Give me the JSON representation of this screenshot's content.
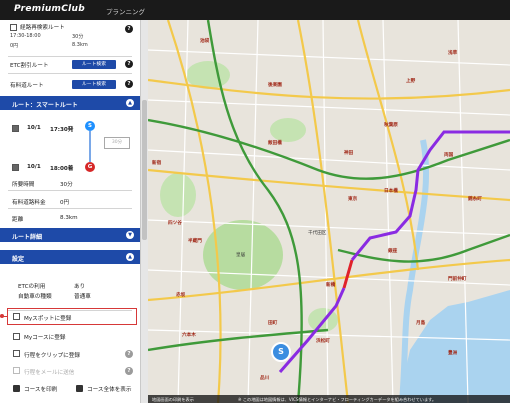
{
  "header": {
    "logo": "PremiumClub",
    "nav": "プランニング"
  },
  "route_summary": {
    "title": "経路再検索ルート",
    "time": "17:30-18:00",
    "duration": "30分",
    "toll": "0円",
    "distance": "8.3km"
  },
  "etc_route": {
    "label": "ETC割引ルート",
    "button": "ルート検索"
  },
  "toll_route": {
    "label": "有料道ルート",
    "button": "ルート検索"
  },
  "smart_route": {
    "section_title": "ルート：スマートルート",
    "start_date": "10/1",
    "start_time": "17:30発",
    "stay_pill": "30分",
    "end_date": "10/1",
    "end_time": "18:00着",
    "start_badge": "S",
    "goal_badge": "G",
    "rows": [
      {
        "label": "所要時間",
        "value": "30分"
      },
      {
        "label": "有料道路料金",
        "value": "0円"
      },
      {
        "label": "距離",
        "value": "8.3km"
      }
    ]
  },
  "route_detail": {
    "title": "ルート詳細"
  },
  "settings": {
    "title": "設定",
    "rows": [
      {
        "label": "ETCの利用",
        "value": "あり"
      },
      {
        "label": "自動車の種類",
        "value": "普通車"
      }
    ]
  },
  "actions": [
    {
      "label": "Myスポットに登録"
    },
    {
      "label": "Myコースに登録"
    },
    {
      "label": "行程をクリップに登録"
    },
    {
      "label": "行程をメールに送信"
    }
  ],
  "footer_actions": {
    "print": "コースを印刷",
    "show_all": "コース全体を表示"
  },
  "map": {
    "start_marker": "S",
    "attribution": "地図画面の印刷を表示",
    "notice": "※ この地図は地図情報は、VICS情報とインターナビ・フローティングカーデータを組み合わせています。",
    "labels": [
      {
        "text": "池袋"
      },
      {
        "text": "後楽園"
      },
      {
        "text": "上野"
      },
      {
        "text": "秋葉原"
      },
      {
        "text": "神田"
      },
      {
        "text": "東京"
      },
      {
        "text": "日本橋"
      },
      {
        "text": "銀座"
      },
      {
        "text": "新橋"
      },
      {
        "text": "浜松町"
      },
      {
        "text": "田町"
      },
      {
        "text": "品川"
      },
      {
        "text": "皇居"
      },
      {
        "text": "半蔵門"
      },
      {
        "text": "赤坂"
      },
      {
        "text": "六本木"
      },
      {
        "text": "新宿"
      },
      {
        "text": "四ツ谷"
      },
      {
        "text": "飯田橋"
      },
      {
        "text": "両国"
      },
      {
        "text": "錦糸町"
      },
      {
        "text": "門前仲町"
      },
      {
        "text": "月島"
      },
      {
        "text": "豊洲"
      },
      {
        "text": "浅草"
      },
      {
        "text": "千代田区"
      }
    ]
  },
  "colors": {
    "brand_blue": "#1e4aa8",
    "route_purple": "#8a2be2",
    "route_red": "#e0222a",
    "highway_green": "#3f9a3a",
    "callout_red": "#d63838"
  }
}
